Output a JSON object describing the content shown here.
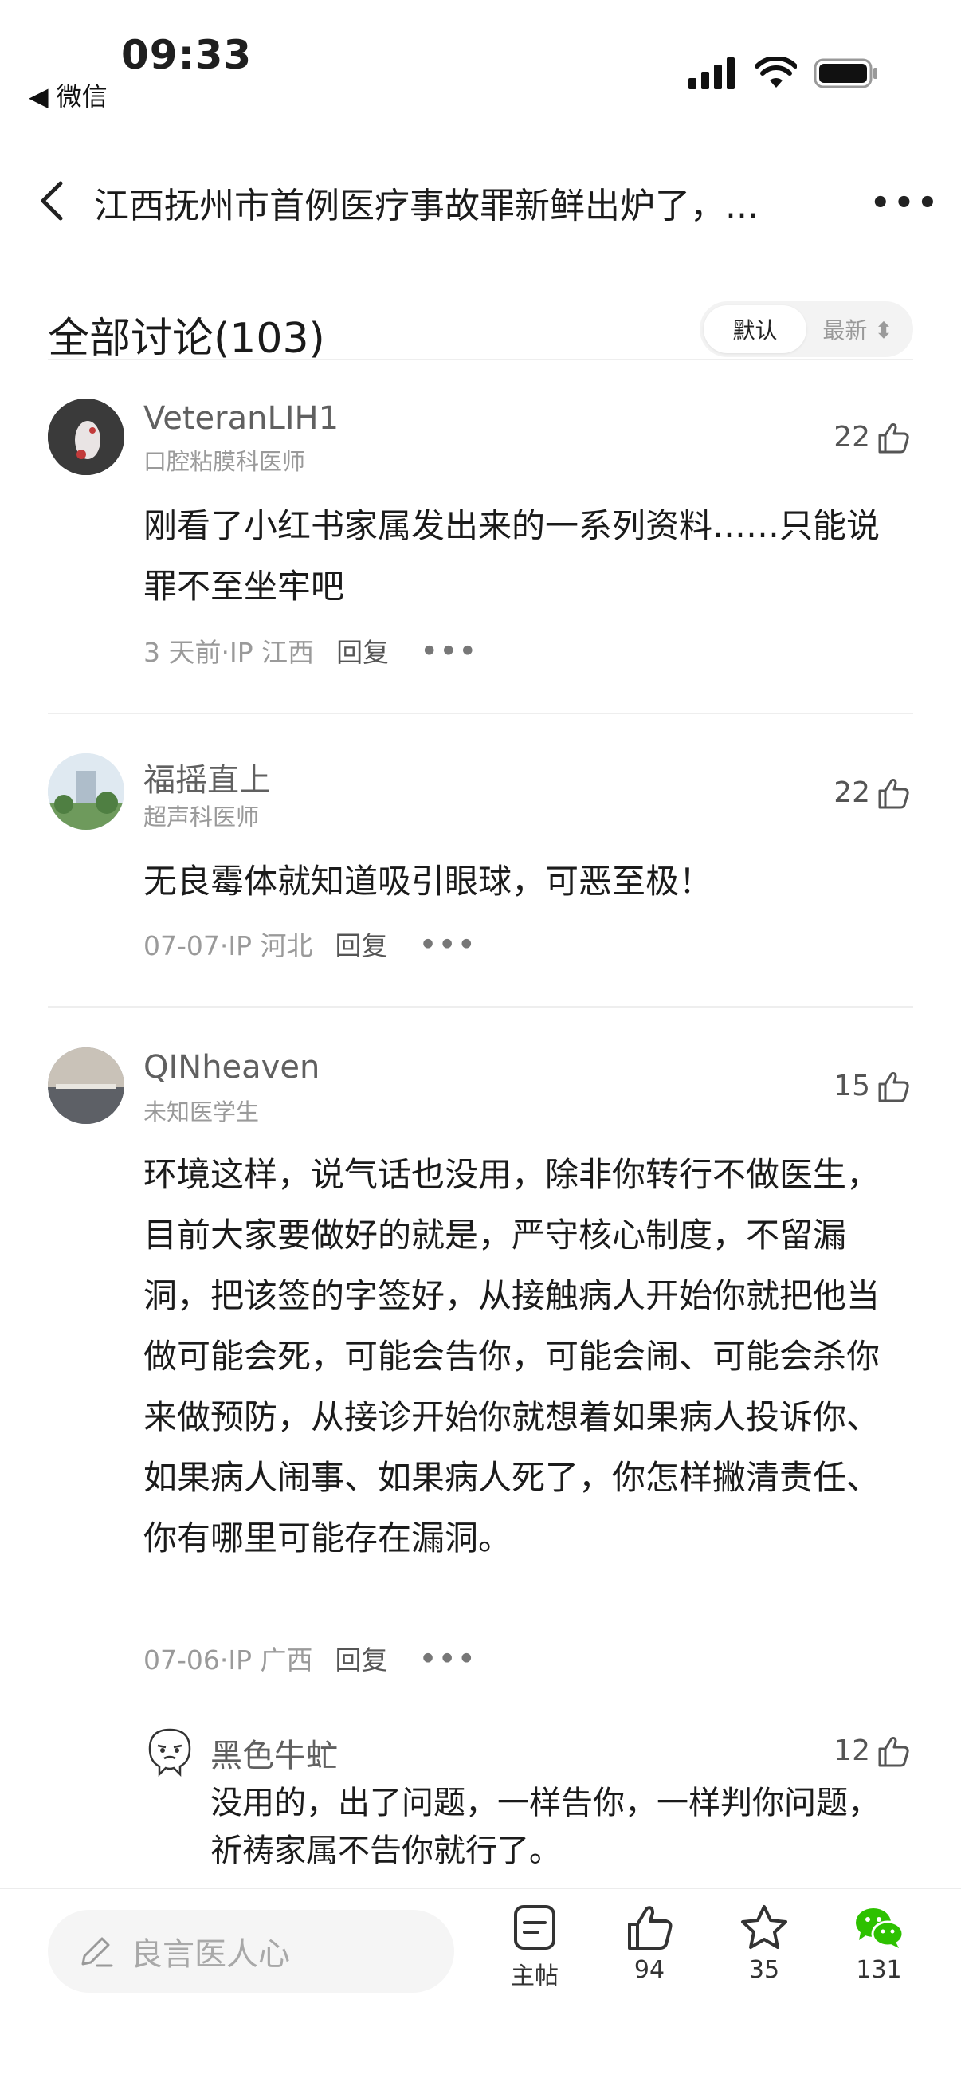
{
  "status_bar": {
    "time": "09:33",
    "back_app": "◀ 微信"
  },
  "nav": {
    "title": "江西抚州市首例医疗事故罪新鲜出炉了，...",
    "more": "•••"
  },
  "discussion": {
    "title": "全部讨论(103)",
    "sort_options": [
      "默认",
      "最新 ⬍"
    ],
    "sort_selected": "默认"
  },
  "comments": [
    {
      "name": "VeteranLIH1",
      "role": "口腔粘膜科医师",
      "likes": "22",
      "body": "刚看了小红书家属发出来的一系列资料……只能说罪不至坐牢吧",
      "meta": "3 天前·IP 江西",
      "reply": "回复",
      "more": "•••"
    },
    {
      "name": "福摇直上",
      "role": "超声科医师",
      "likes": "22",
      "body": "无良霉体就知道吸引眼球，可恶至极！",
      "meta": "07-07·IP 河北",
      "reply": "回复",
      "more": "•••"
    },
    {
      "name": "QINheaven",
      "role": "未知医学生",
      "likes": "15",
      "body": "环境这样，说气话也没用，除非你转行不做医生，目前大家要做好的就是，严守核心制度，不留漏洞，把该签的字签好，从接触病人开始你就把他当做可能会死，可能会告你，可能会闹、可能会杀你来做预防，从接诊开始你就想着如果病人投诉你、如果病人闹事、如果病人死了，你怎样撇清责任、你有哪里可能存在漏洞。",
      "meta": "07-06·IP 广西",
      "reply": "回复",
      "more": "•••"
    }
  ],
  "reply": {
    "name": "黑色牛虻",
    "likes": "12",
    "body": "没用的，出了问题，一样告你，一样判你问题，祈祷家属不告你就行了。"
  },
  "bottom_bar": {
    "input_placeholder": "良言医人心",
    "post_label": "主帖",
    "like_count": "94",
    "star_count": "35",
    "share_count": "131"
  },
  "colors": {
    "wechat_green": "#2dc100",
    "text_gray": "#9a9a9a"
  }
}
